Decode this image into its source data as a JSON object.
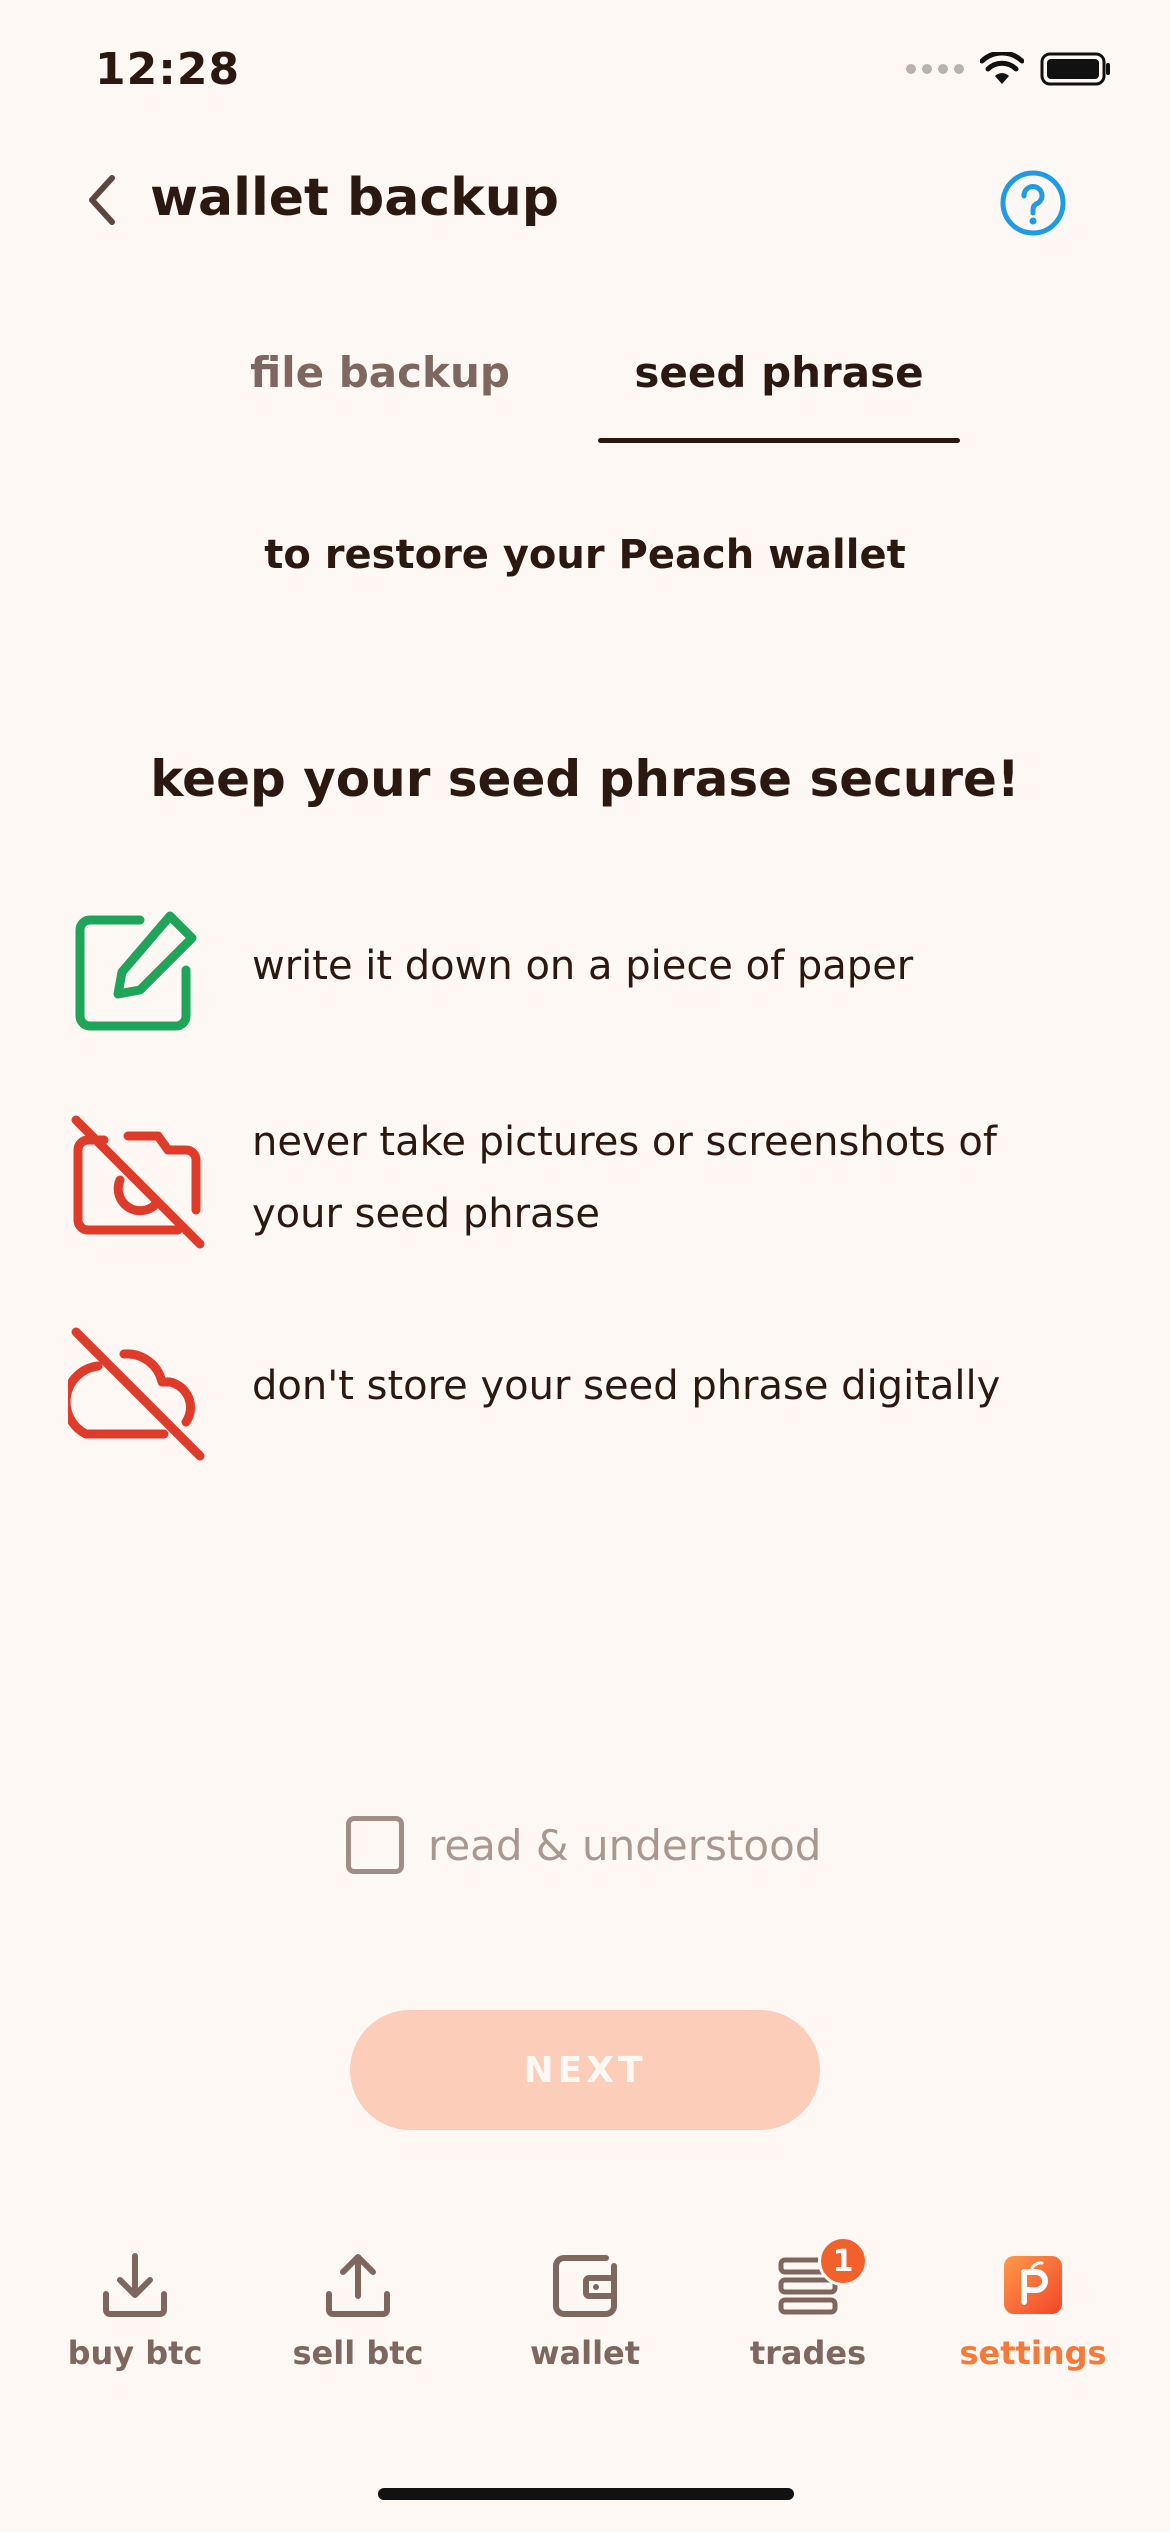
{
  "status_bar": {
    "time": "12:28"
  },
  "header": {
    "title": "wallet backup"
  },
  "tabs": [
    {
      "label": "file backup",
      "active": false
    },
    {
      "label": "seed phrase",
      "active": true
    }
  ],
  "subtitle": "to restore your Peach wallet",
  "heading": "keep your seed phrase secure!",
  "items": [
    {
      "icon": "edit-icon",
      "text": "write it down on a piece of paper",
      "color": "#1EA55A"
    },
    {
      "icon": "camera-off-icon",
      "text": "never take pictures or screenshots of your seed phrase",
      "color": "#DF3B2B"
    },
    {
      "icon": "cloud-off-icon",
      "text": "don't store your seed phrase digitally",
      "color": "#DF3B2B"
    }
  ],
  "checkbox": {
    "label": "read & understood",
    "checked": false
  },
  "next_button": {
    "label": "NEXT",
    "enabled": false
  },
  "nav": {
    "items": [
      {
        "label": "buy btc",
        "icon": "download-icon"
      },
      {
        "label": "sell btc",
        "icon": "upload-icon"
      },
      {
        "label": "wallet",
        "icon": "wallet-icon"
      },
      {
        "label": "trades",
        "icon": "trades-icon",
        "badge": "1"
      },
      {
        "label": "settings",
        "icon": "peach-icon",
        "active": true
      }
    ]
  },
  "colors": {
    "accent": "#F57A3A",
    "help": "#1E9BE3",
    "background": "#FEF8F5"
  }
}
